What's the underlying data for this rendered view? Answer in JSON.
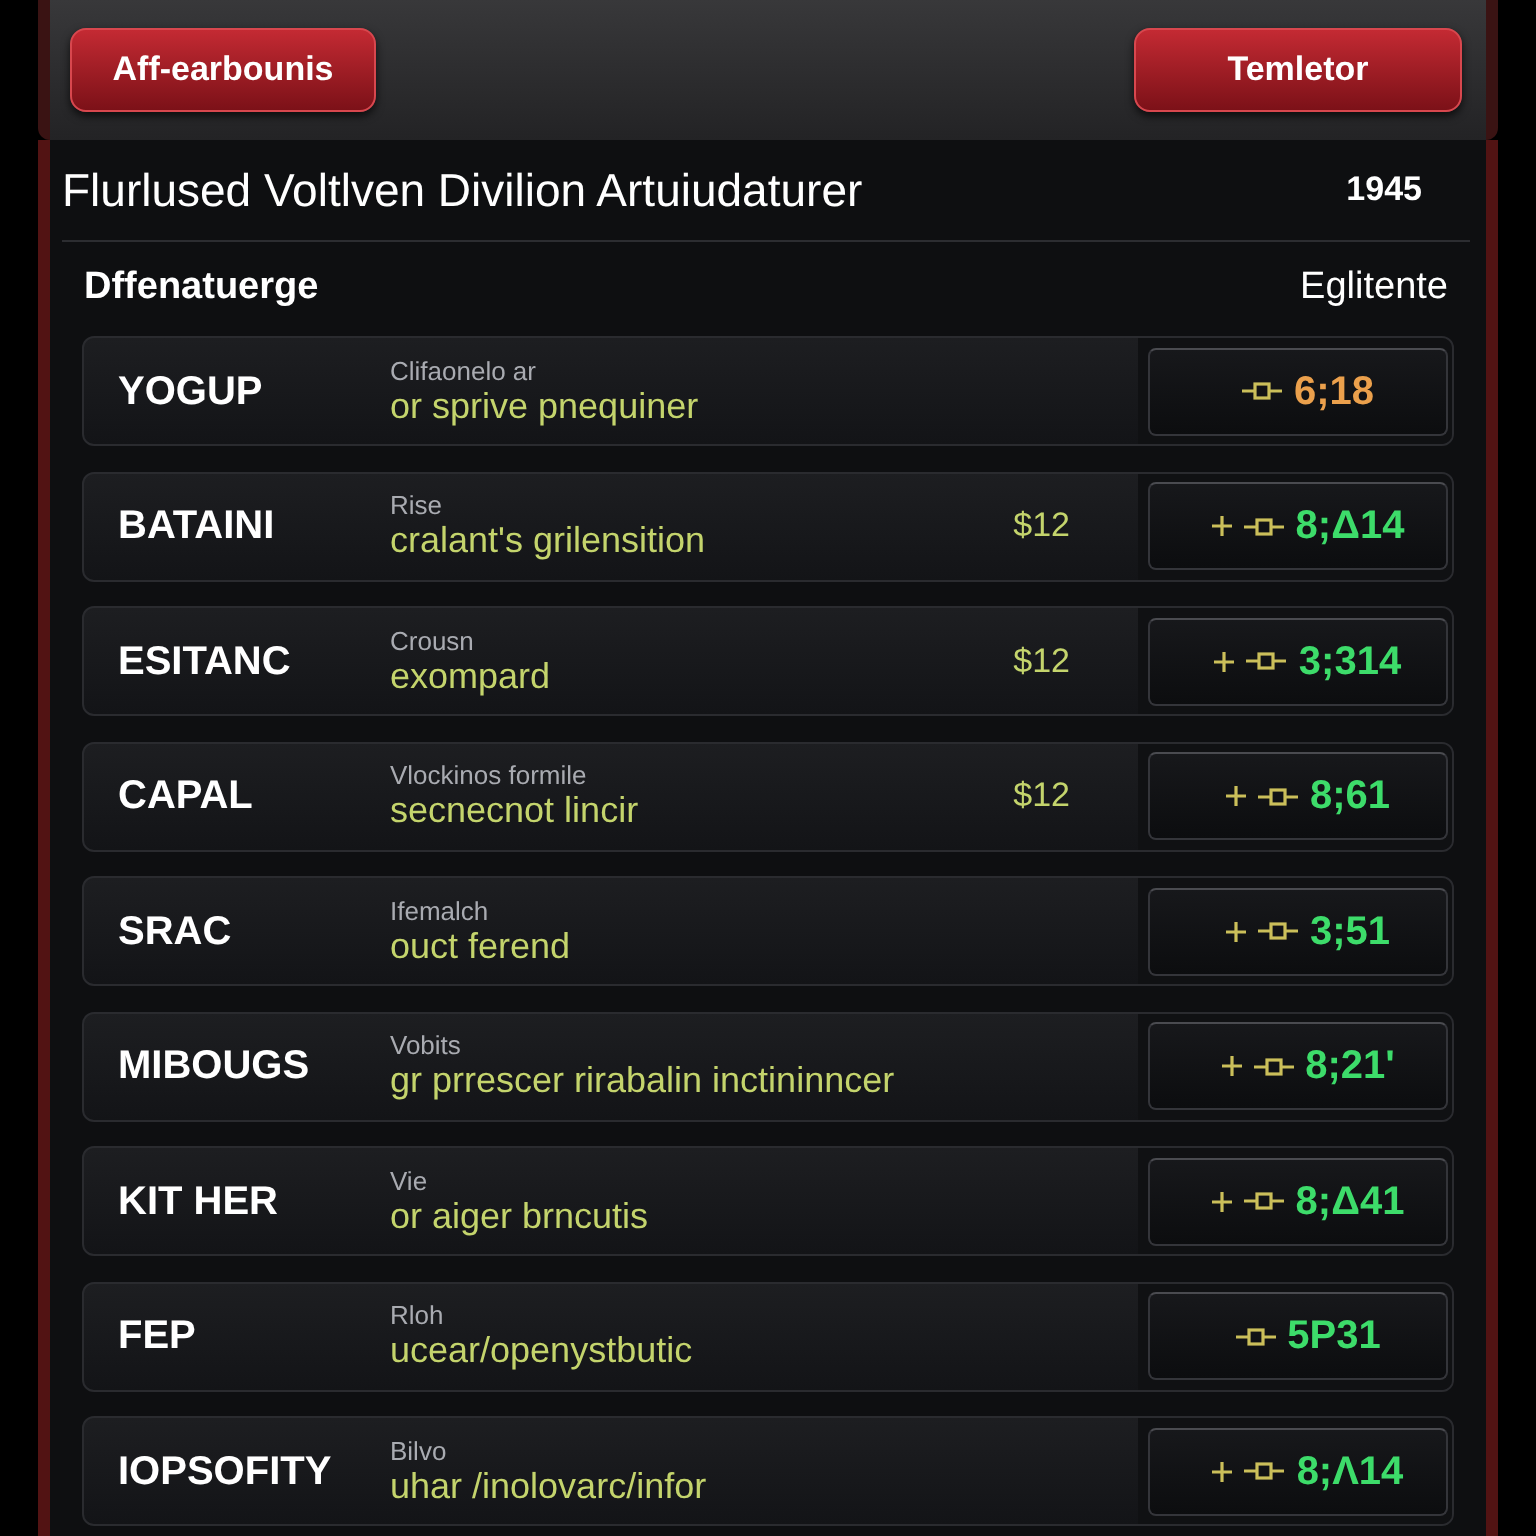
{
  "top_bar": {
    "buttons": [
      "Aff-earbounis",
      "Temletor"
    ]
  },
  "panel": {
    "title": "Flurlused Voltlven Divilion Artuiudaturer",
    "year": "1945",
    "column_left": "Dffenatuerge",
    "column_right": "Eglitente",
    "rows": [
      {
        "name": "YOGUP",
        "label": "Clifaonelo ar",
        "description": "or sprive pnequiner",
        "value": "6;18",
        "color": "#eba04c",
        "has_plus": false
      },
      {
        "name": "BATAINI",
        "label": "Rise",
        "description": "cralant's grilensition",
        "price": "$12",
        "value": "8;Δ14",
        "color": "#3ddc6a",
        "has_plus": true
      },
      {
        "name": "ESITANC",
        "label": "Crousn",
        "description": "exompard",
        "price": "$12",
        "value": "3;314",
        "color": "#3ddc6a",
        "has_plus": true
      },
      {
        "name": "CAPAL",
        "label": "Vlockinos formile",
        "description": "secnecnot lincir",
        "price": "$12",
        "value": "8;61",
        "color": "#3ddc6a",
        "has_plus": true
      },
      {
        "name": "SRAC",
        "label": "Ifemalch",
        "description": "ouct ferend",
        "value": "3;51",
        "color": "#3ddc6a",
        "has_plus": true
      },
      {
        "name": "MIBOUGS",
        "label": "Vobits",
        "description": "gr prrescer rirabalin inctininncer",
        "value": "8;21'",
        "color": "#3ddc6a",
        "has_plus": true
      },
      {
        "name": "KIT HER",
        "label": "Vie",
        "description": "or aiger brncutis",
        "value": "8;Δ41",
        "color": "#3ddc6a",
        "has_plus": true
      },
      {
        "name": "FEP",
        "label": "Rloh",
        "description": "ucear/openystbutic",
        "value": "5P31",
        "color": "#3ddc6a",
        "has_plus": false
      },
      {
        "name": "IOPSOFITY",
        "label": "Bilvo",
        "description": "uhar /inolovarc/infor",
        "value": "8;Λ14",
        "color": "#3ddc6a",
        "has_plus": true
      }
    ]
  }
}
